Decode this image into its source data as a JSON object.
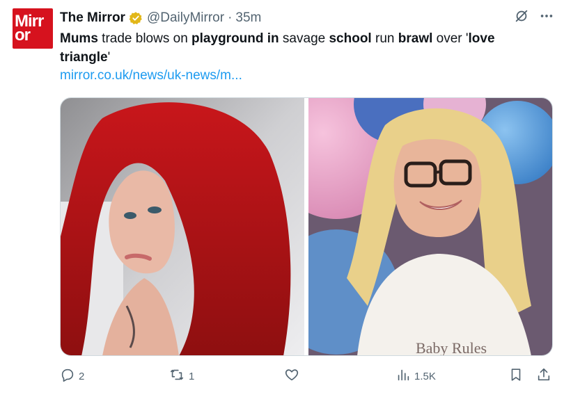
{
  "account": {
    "avatar_text_line1": "Mirr",
    "avatar_text_line2": "or",
    "name": "The Mirror",
    "handle": "@DailyMirror",
    "separator": "·",
    "time": "35m"
  },
  "tweet": {
    "segments": [
      {
        "text": "Mums",
        "bold": true
      },
      {
        "text": " trade blows on ",
        "bold": false
      },
      {
        "text": "playground in",
        "bold": true
      },
      {
        "text": " savage ",
        "bold": false
      },
      {
        "text": "school",
        "bold": true
      },
      {
        "text": " run ",
        "bold": false
      },
      {
        "text": "brawl",
        "bold": true
      },
      {
        "text": " over '",
        "bold": false
      },
      {
        "text": "love triangle",
        "bold": true
      },
      {
        "text": "'",
        "bold": false
      }
    ],
    "link": "mirror.co.uk/news/uk-news/m..."
  },
  "media": {
    "photo_right_shirt_text": "Baby Rules"
  },
  "actions": {
    "replies": "2",
    "retweets": "1",
    "likes": "",
    "views": "1.5K"
  },
  "colors": {
    "brand_red": "#d6121e",
    "link_blue": "#1d9bf0",
    "verified_gold": "#e2b719",
    "muted": "#536471"
  },
  "icons": [
    "grok-icon",
    "more-icon",
    "verified-badge-icon",
    "reply-icon",
    "retweet-icon",
    "like-icon",
    "views-icon",
    "bookmark-icon",
    "share-icon"
  ]
}
